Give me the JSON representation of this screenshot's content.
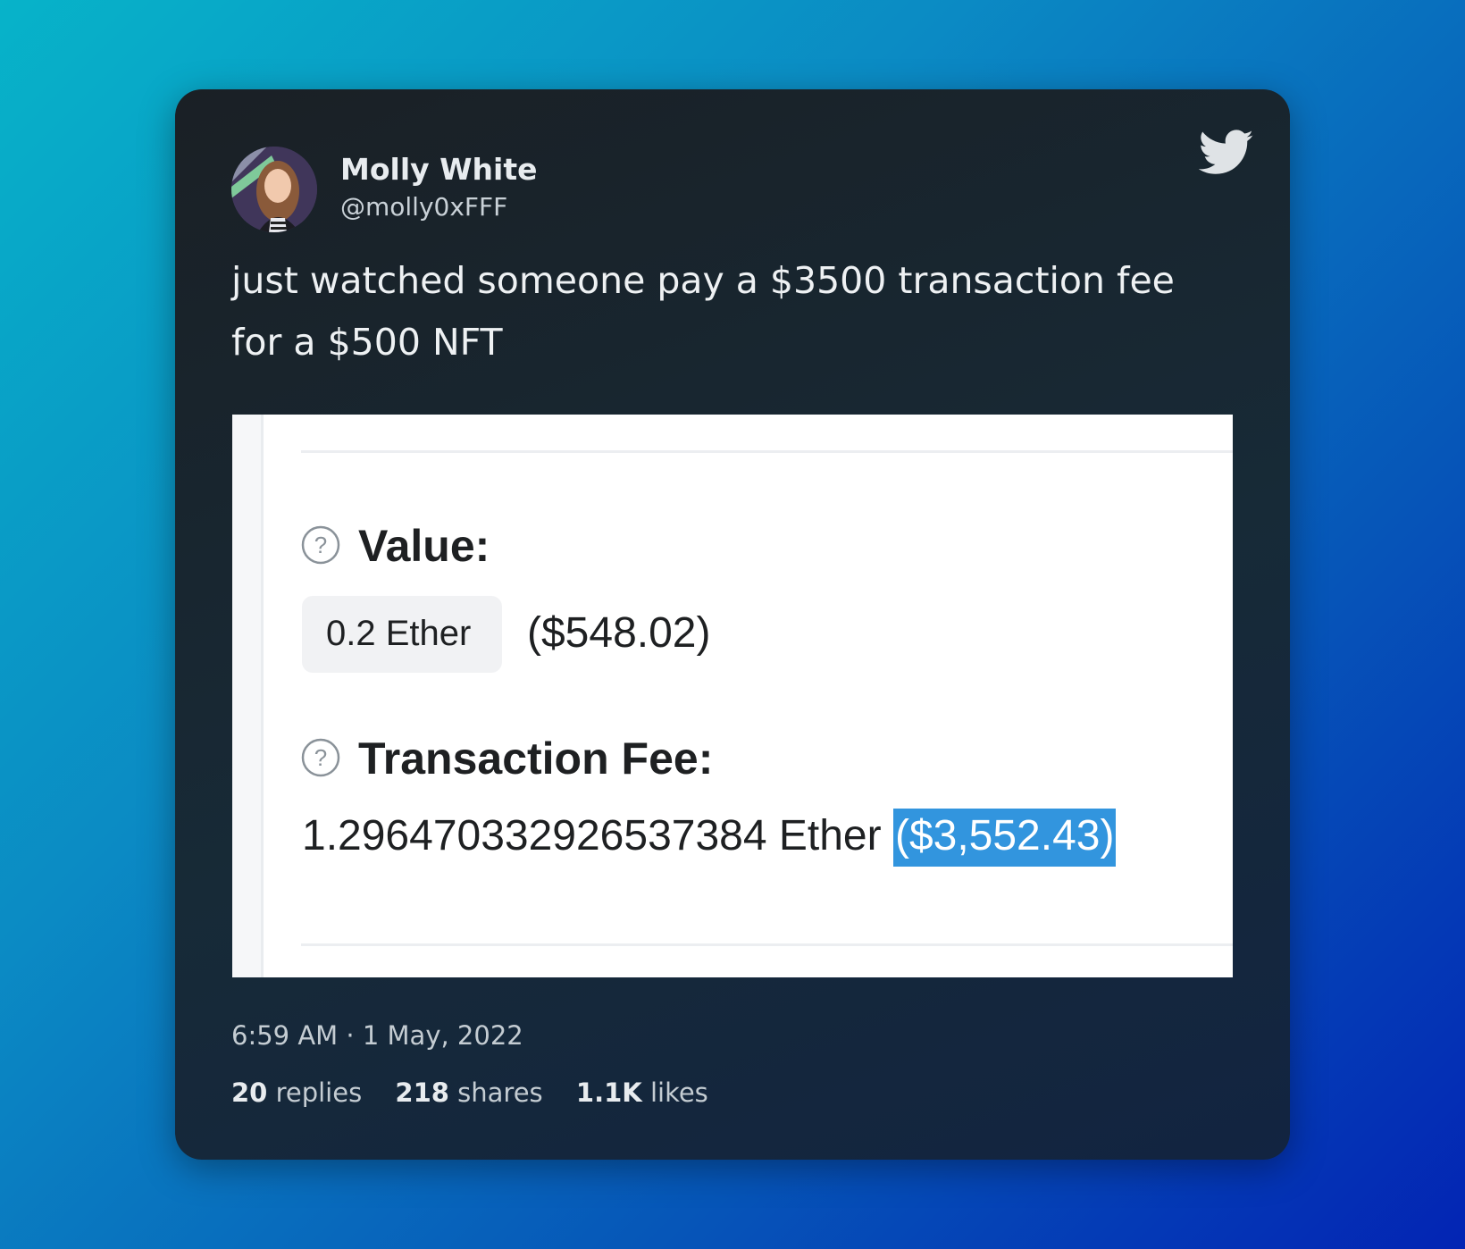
{
  "tweet": {
    "author": {
      "name": "Molly White",
      "handle": "@molly0xFFF"
    },
    "text": "just watched someone pay a $3500 transaction fee for a $500 NFT",
    "timestamp": "6:59 AM · 1 May, 2022",
    "stats": {
      "replies_count": "20",
      "replies_label": "replies",
      "shares_count": "218",
      "shares_label": "shares",
      "likes_count": "1.1K",
      "likes_label": "likes"
    }
  },
  "media": {
    "value_label": "Value:",
    "value_ether": "0.2 Ether",
    "value_usd": "($548.02)",
    "fee_label": "Transaction Fee:",
    "fee_ether": "1.296470332926537384 Ether",
    "fee_usd": "($3,552.43)"
  },
  "icons": {
    "brand": "twitter-bird-icon",
    "help": "question-circle-icon"
  },
  "colors": {
    "card_bg": "#1a2025",
    "text": "#eef1f3",
    "highlight": "#3295de",
    "bird": "#dfe3e6"
  }
}
